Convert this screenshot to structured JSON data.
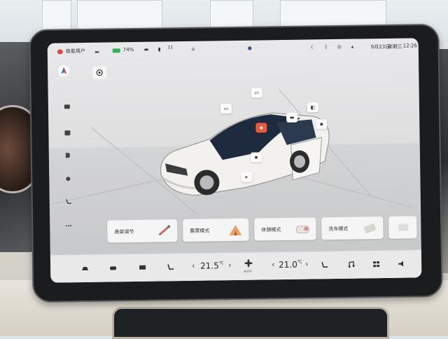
{
  "status_bar": {
    "user": "极氪用户",
    "battery": "74%",
    "signal_value": "11",
    "date": "9月23日",
    "weekday": "星期三",
    "time": "12:26"
  },
  "side_icons": [
    "camera-icon",
    "parking-icon",
    "headlight-icon",
    "light-icon",
    "seat-icon",
    "more-icon"
  ],
  "car_hotspots": [
    "door-icon",
    "door-icon",
    "hood-icon",
    "mirror-icon",
    "trunk-icon",
    "light-icon",
    "flat-icon"
  ],
  "mode_cards": [
    {
      "label": "悬架调节"
    },
    {
      "label": "露营模式"
    },
    {
      "label": "休憩模式"
    },
    {
      "label": "洗车模式"
    }
  ],
  "climate": {
    "left_temp": "21.5",
    "right_temp": "21.0",
    "unit": "℃",
    "fan_label": "AUTO"
  },
  "colors": {
    "accent_red": "#e9593e",
    "battery_green": "#2fb25b",
    "screen_bg": "#e3e3e5"
  }
}
